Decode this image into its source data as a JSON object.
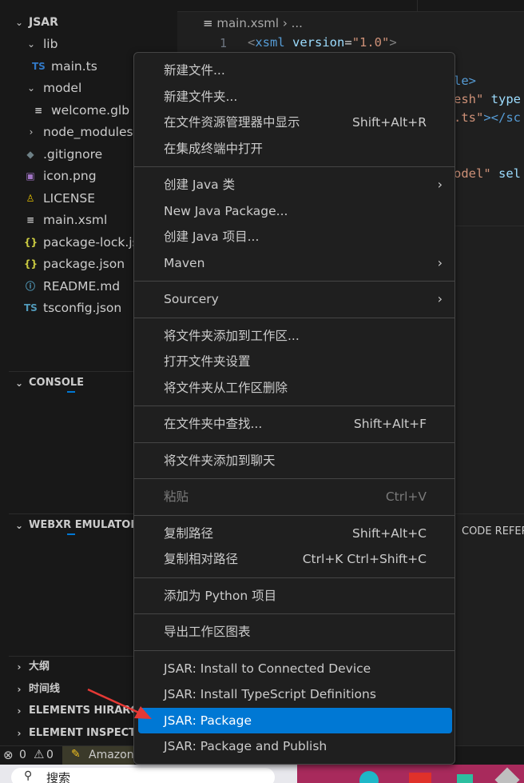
{
  "explorer": {
    "root_label": "JSAR",
    "items": [
      {
        "label": "lib",
        "chevron": "⌄",
        "icon": "",
        "icon_color": ""
      },
      {
        "label": "main.ts",
        "chevron": "",
        "icon": "TS",
        "icon_color": "#3178c6"
      },
      {
        "label": "model",
        "chevron": "⌄",
        "icon": "",
        "icon_color": ""
      },
      {
        "label": "welcome.glb",
        "chevron": "",
        "icon": "≡",
        "icon_color": "#cccccc"
      },
      {
        "label": "node_modules",
        "chevron": "›",
        "icon": "",
        "icon_color": ""
      },
      {
        "label": ".gitignore",
        "chevron": "",
        "icon": "◆",
        "icon_color": "#6d8086"
      },
      {
        "label": "icon.png",
        "chevron": "",
        "icon": "▣",
        "icon_color": "#a074c4"
      },
      {
        "label": "LICENSE",
        "chevron": "",
        "icon": "♙",
        "icon_color": "#e5c100"
      },
      {
        "label": "main.xsml",
        "chevron": "",
        "icon": "≡",
        "icon_color": "#cccccc"
      },
      {
        "label": "package-lock.json",
        "chevron": "",
        "icon": "{}",
        "icon_color": "#cbcb41"
      },
      {
        "label": "package.json",
        "chevron": "",
        "icon": "{}",
        "icon_color": "#cbcb41"
      },
      {
        "label": "README.md",
        "chevron": "",
        "icon": "ⓘ",
        "icon_color": "#519aba"
      },
      {
        "label": "tsconfig.json",
        "chevron": "",
        "icon": "TS",
        "icon_color": "#519aba"
      }
    ],
    "sections": {
      "console": "CONSOLE",
      "webxr": "WEBXR EMULATOR",
      "outline": "大纲",
      "timeline": "时间线",
      "elements_hierarchy": "ELEMENTS HIRARCHY",
      "element_inspector": "ELEMENT INSPECTOR"
    }
  },
  "editor": {
    "breadcrumb_file": "main.xsml",
    "breadcrumb_more": "...",
    "line_number": "1",
    "line1": {
      "lt": "<",
      "tag": "xsml",
      "attr": "version",
      "eq": "=",
      "val": "\"1.0\"",
      "gt": ">"
    },
    "frag_le": "le>",
    "frag_esh_str": "esh\"",
    "frag_esh_attr": "type",
    "frag_ts_str": ".ts\"",
    "frag_ts_tag": "></sc",
    "frag_odel_str": "odel\"",
    "frag_odel_attr": "sel",
    "panel_tab": "CODE REFERE"
  },
  "status_bar": {
    "errors": "0",
    "warnings": "0",
    "amazon_label": "Amazon"
  },
  "taskbar": {
    "search_text": "搜索"
  },
  "context_menu": {
    "groups": [
      [
        {
          "label": "新建文件...",
          "shortcut": "",
          "submenu": false,
          "disabled": false,
          "selected": false
        },
        {
          "label": "新建文件夹...",
          "shortcut": "",
          "submenu": false,
          "disabled": false,
          "selected": false
        },
        {
          "label": "在文件资源管理器中显示",
          "shortcut": "Shift+Alt+R",
          "submenu": false,
          "disabled": false,
          "selected": false
        },
        {
          "label": "在集成终端中打开",
          "shortcut": "",
          "submenu": false,
          "disabled": false,
          "selected": false
        }
      ],
      [
        {
          "label": "创建 Java 类",
          "shortcut": "",
          "submenu": true,
          "disabled": false,
          "selected": false
        },
        {
          "label": "New Java Package...",
          "shortcut": "",
          "submenu": false,
          "disabled": false,
          "selected": false
        },
        {
          "label": "创建 Java 项目...",
          "shortcut": "",
          "submenu": false,
          "disabled": false,
          "selected": false
        },
        {
          "label": "Maven",
          "shortcut": "",
          "submenu": true,
          "disabled": false,
          "selected": false
        }
      ],
      [
        {
          "label": "Sourcery",
          "shortcut": "",
          "submenu": true,
          "disabled": false,
          "selected": false
        }
      ],
      [
        {
          "label": "将文件夹添加到工作区...",
          "shortcut": "",
          "submenu": false,
          "disabled": false,
          "selected": false
        },
        {
          "label": "打开文件夹设置",
          "shortcut": "",
          "submenu": false,
          "disabled": false,
          "selected": false
        },
        {
          "label": "将文件夹从工作区删除",
          "shortcut": "",
          "submenu": false,
          "disabled": false,
          "selected": false
        }
      ],
      [
        {
          "label": "在文件夹中查找...",
          "shortcut": "Shift+Alt+F",
          "submenu": false,
          "disabled": false,
          "selected": false
        }
      ],
      [
        {
          "label": "将文件夹添加到聊天",
          "shortcut": "",
          "submenu": false,
          "disabled": false,
          "selected": false
        }
      ],
      [
        {
          "label": "粘贴",
          "shortcut": "Ctrl+V",
          "submenu": false,
          "disabled": true,
          "selected": false
        }
      ],
      [
        {
          "label": "复制路径",
          "shortcut": "Shift+Alt+C",
          "submenu": false,
          "disabled": false,
          "selected": false
        },
        {
          "label": "复制相对路径",
          "shortcut": "Ctrl+K Ctrl+Shift+C",
          "submenu": false,
          "disabled": false,
          "selected": false
        }
      ],
      [
        {
          "label": "添加为 Python 项目",
          "shortcut": "",
          "submenu": false,
          "disabled": false,
          "selected": false
        }
      ],
      [
        {
          "label": "导出工作区图表",
          "shortcut": "",
          "submenu": false,
          "disabled": false,
          "selected": false
        }
      ],
      [
        {
          "label": "JSAR: Install to Connected Device",
          "shortcut": "",
          "submenu": false,
          "disabled": false,
          "selected": false
        },
        {
          "label": "JSAR: Install TypeScript Definitions",
          "shortcut": "",
          "submenu": false,
          "disabled": false,
          "selected": false
        },
        {
          "label": "JSAR: Package",
          "shortcut": "",
          "submenu": false,
          "disabled": false,
          "selected": true
        },
        {
          "label": "JSAR: Package and Publish",
          "shortcut": "",
          "submenu": false,
          "disabled": false,
          "selected": false
        }
      ]
    ]
  },
  "annotation": {
    "arrow_color": "#e53935"
  }
}
